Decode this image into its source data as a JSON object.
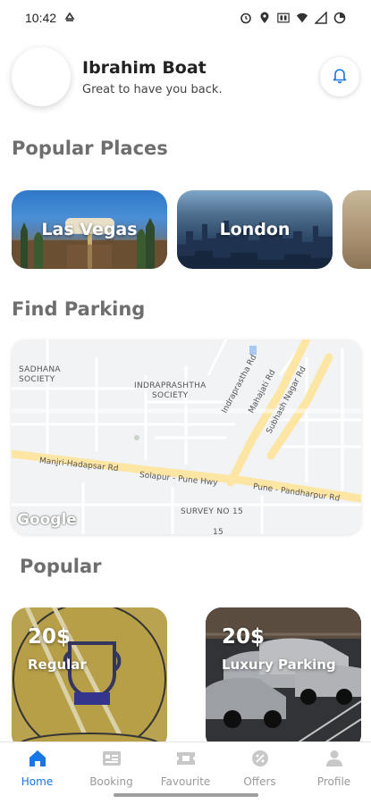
{
  "status_bar": {
    "time": "10:42"
  },
  "header": {
    "user_name": "Ibrahim Boat",
    "greeting": "Great to have you back."
  },
  "sections": {
    "popular_places": "Popular Places",
    "find_parking": "Find Parking",
    "popular": "Popular"
  },
  "places": [
    {
      "label": "Las Vegas"
    },
    {
      "label": "London"
    },
    {
      "label": ""
    }
  ],
  "map": {
    "labels": {
      "sadhana": "SADHANA\nSOCIETY",
      "indraprashtha": "INDRAPRASHTHA\nSOCIETY",
      "survey": "SURVEY NO 15",
      "fifteen": "15"
    },
    "roads": {
      "indraprastha_rd": "Indraprastha Rd",
      "mahajati_rd": "Mahajati Rd",
      "subhash_nagar_rd": "Subhash Nagar Rd",
      "manjri_hadapsar": "Manjri-Hadapsar Rd",
      "solapur_pune": "Solapur - Pune Hwy",
      "pune_pandharpur": "Pune - Pandharpur Rd"
    },
    "attribution": "Google"
  },
  "popular_cards": [
    {
      "price": "20$",
      "name": "Regular"
    },
    {
      "price": "20$",
      "name": "Luxury Parking"
    }
  ],
  "nav": [
    {
      "label": "Home",
      "icon": "home-icon",
      "active": true
    },
    {
      "label": "Booking",
      "icon": "booking-icon",
      "active": false
    },
    {
      "label": "Favourite",
      "icon": "ticket-icon",
      "active": false
    },
    {
      "label": "Offers",
      "icon": "offer-icon",
      "active": false
    },
    {
      "label": "Profile",
      "icon": "person-icon",
      "active": false
    }
  ],
  "colors": {
    "accent": "#1976e6",
    "section_title": "#6e6e6e",
    "inactive_nav": "#9a9a9a"
  }
}
